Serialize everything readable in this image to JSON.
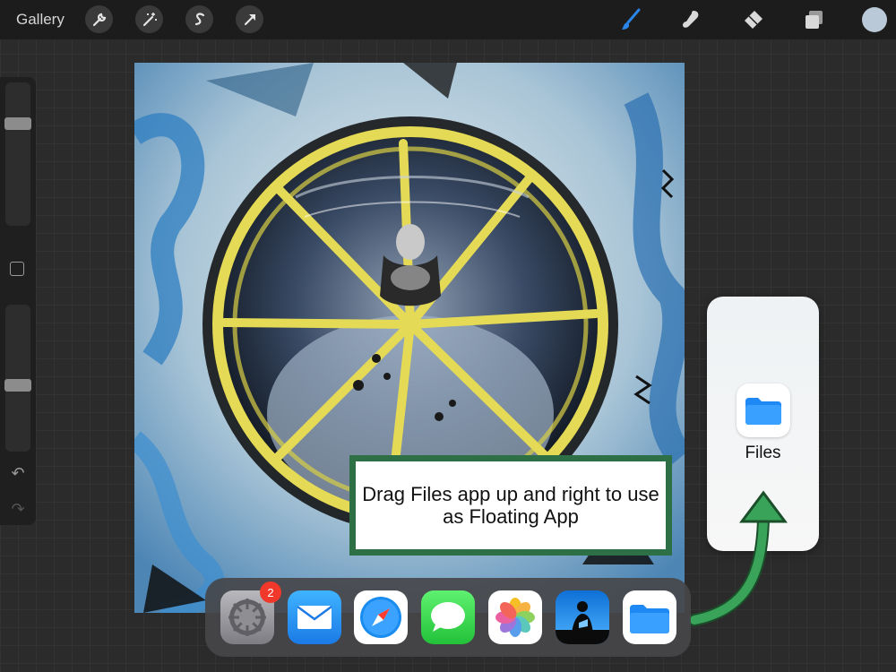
{
  "toolbar": {
    "gallery_label": "Gallery",
    "left_tools": [
      "wrench-icon",
      "magic-wand-icon",
      "selection-s-icon",
      "transform-arrow-icon"
    ],
    "right_tools": [
      "brush-icon",
      "smudge-icon",
      "eraser-icon",
      "layers-icon"
    ],
    "active_color": "#b9c9d8",
    "accent": "#2b84e8"
  },
  "sidebar": {
    "brush_size_level": 0.73,
    "opacity_level": 0.45
  },
  "callout": {
    "text": "Drag Files app up and right to use as Floating App"
  },
  "files_card": {
    "label": "Files"
  },
  "dock": {
    "apps": [
      "Settings",
      "Mail",
      "Safari",
      "Messages",
      "Photos",
      "Kindle",
      "Files"
    ],
    "settings_badge": "2"
  },
  "colors": {
    "arrow_green": "#3aa35a",
    "callout_border": "#2e7045",
    "badge_red": "#f0392b"
  }
}
